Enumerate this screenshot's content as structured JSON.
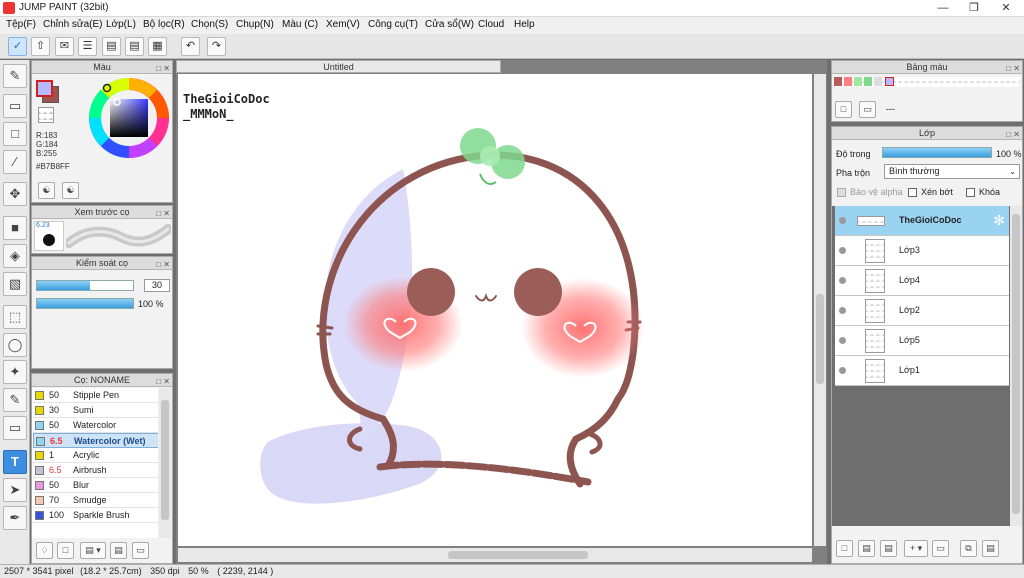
{
  "window": {
    "title": "JUMP PAINT (32bit)"
  },
  "menu": [
    "Tệp(F)",
    "Chỉnh sửa(E)",
    "Lớp(L)",
    "Bộ lọc(R)",
    "Chọn(S)",
    "Chụp(N)",
    "Màu (C)",
    "Xem(V)",
    "Công cụ(T)",
    "Cửa sổ(W)",
    "Cloud",
    "Help"
  ],
  "color_panel": {
    "title": "Màu",
    "r": "R:183",
    "g": "G:184",
    "b": "B:255",
    "hex": "#B7B8FF",
    "primary_color": "#B7B8FF",
    "secondary_color": "#a0524c"
  },
  "brush_preview": {
    "title": "Xem trước cọ",
    "size_label": "6.23"
  },
  "brush_control": {
    "title": "Kiểm soát cọ",
    "size_value": "30",
    "opacity_value": "100 %",
    "size_fill": 0.55,
    "opacity_fill": 1.0
  },
  "brush_list": {
    "title": "Cọ: NONAME",
    "items": [
      {
        "size": "50",
        "name": "Stipple Pen",
        "color": "#e8d800"
      },
      {
        "size": "30",
        "name": "Sumi",
        "color": "#e8d800"
      },
      {
        "size": "50",
        "name": "Watercolor",
        "color": "#8ed6f0"
      },
      {
        "size": "6.5",
        "name": "Watercolor (Wet)",
        "color": "#8ed6f0",
        "selected": true
      },
      {
        "size": "1",
        "name": "Acrylic",
        "color": "#e8d800"
      },
      {
        "size": "6.5",
        "name": "Airbrush",
        "color": "#c9c0d8"
      },
      {
        "size": "50",
        "name": "Blur",
        "color": "#e59ae0"
      },
      {
        "size": "70",
        "name": "Smudge",
        "color": "#f3c9b6"
      },
      {
        "size": "100",
        "name": "Sparkle Brush",
        "color": "#3a53d6"
      }
    ]
  },
  "document": {
    "tab": "Untitled",
    "watermark_line1": "TheGioiCoDoc",
    "watermark_line2": "_MMMoN_"
  },
  "palette": {
    "title": "Bảng màu",
    "empty_label": "---"
  },
  "layers": {
    "title": "Lớp",
    "opacity_label": "Độ trong",
    "opacity_value": "100 %",
    "blend_label": "Pha trộn",
    "blend_value": "Bình thường",
    "protect_alpha": "Bảo vệ alpha",
    "clipping": "Xén bớt",
    "lock": "Khóa",
    "items": [
      {
        "name": "TheGioiCoDoc",
        "selected": true
      },
      {
        "name": "Lớp3"
      },
      {
        "name": "Lớp4"
      },
      {
        "name": "Lớp2"
      },
      {
        "name": "Lớp5"
      },
      {
        "name": "Lớp1"
      }
    ]
  },
  "status": {
    "dimensions": "2507 * 3541 pixel",
    "physical": "(18.2 * 25.7cm)",
    "dpi": "350 dpi",
    "zoom": "50 %",
    "coords": "( 2239, 2144 )"
  }
}
